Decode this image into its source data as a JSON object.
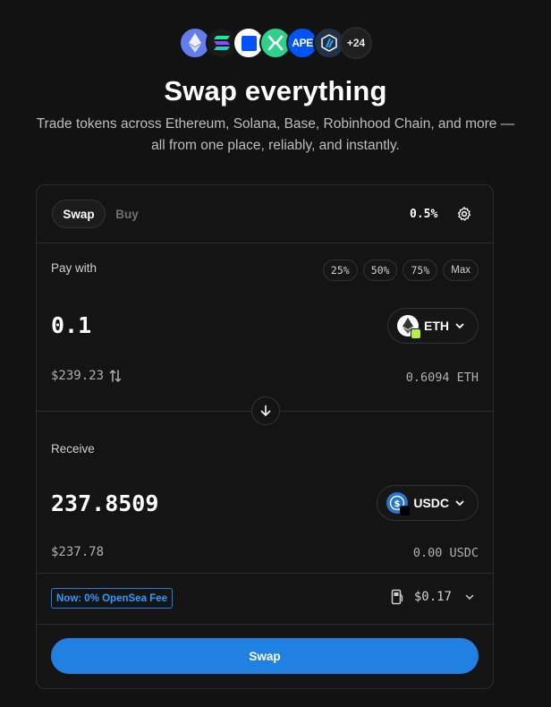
{
  "chains": {
    "icons": [
      "ethereum-icon",
      "solana-icon",
      "base-icon",
      "xs-chain-icon",
      "apechain-icon",
      "arbitrum-icon"
    ],
    "more_label": "+24"
  },
  "hero": {
    "title": "Swap everything",
    "subtitle": "Trade tokens across Ethereum, Solana, Base, Robinhood Chain, and more — all from one place, reliably, and instantly."
  },
  "tabs": {
    "swap": "Swap",
    "buy": "Buy"
  },
  "slippage": "0.5%",
  "pay": {
    "label": "Pay with",
    "presets": [
      "25%",
      "50%",
      "75%",
      "Max"
    ],
    "amount": "0.1",
    "token": "ETH",
    "usd_value": "$239.23",
    "balance": "0.6094 ETH"
  },
  "receive": {
    "label": "Receive",
    "amount": "237.8509",
    "token": "USDC",
    "usd_value": "$237.78",
    "balance": "0.00 USDC"
  },
  "fee": {
    "badge": "Now: 0% OpenSea Fee",
    "gas": "$0.17"
  },
  "swap_button": "Swap",
  "colors": {
    "background": "#121212",
    "accent": "#2081e2",
    "eth": "#627eea",
    "usdc": "#2775ca"
  }
}
